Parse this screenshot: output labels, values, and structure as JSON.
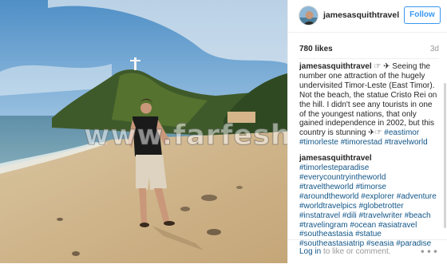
{
  "photo": {
    "watermark": "www.farfesh.com"
  },
  "header": {
    "username": "jamesasquithtravel",
    "follow_label": "Follow"
  },
  "stats": {
    "likes": "780 likes",
    "time": "3d"
  },
  "caption": {
    "username": "jamesasquithtravel",
    "text": " ☞ ✈ Seeing the number one attraction of the hugely undervisited Timor-Leste (East Timor). Not the beach, the statue Cristo Rei on the hill. I didn't see any tourists in one of the youngest nations, that only gained independence in 2002, but this country is stunning ✈☞ ",
    "hashtags": [
      "#eastimor",
      "#timorleste",
      "#timorestad",
      "#travelworld"
    ]
  },
  "comment": {
    "username": "jamesasquithtravel",
    "hashtags": [
      "#timorlesteparadise",
      "#everycountryintheworld",
      "#traveltheworld",
      "#timorse",
      "#aroundtheworld",
      "#explorer",
      "#adventure",
      "#worldtravelpics",
      "#globetrotter",
      "#instatravel",
      "#dili",
      "#travelwriter",
      "#beach",
      "#travelingram",
      "#ocean",
      "#asiatravel",
      "#southeastasia",
      "#statue",
      "#southeastasiatrip",
      "#seasia",
      "#paradise"
    ]
  },
  "footer": {
    "login_link": "Log in",
    "login_rest": " to like or comment.",
    "more_icon": "more-icon"
  },
  "colors": {
    "link": "#125688",
    "follow": "#3897f0"
  }
}
